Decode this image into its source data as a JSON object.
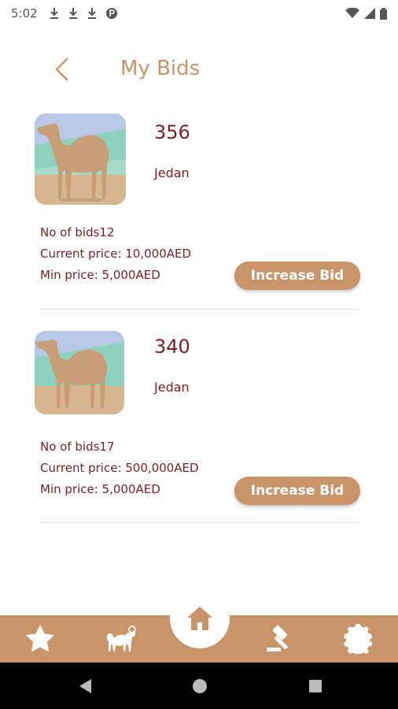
{
  "status_bar": {
    "time": "5:02",
    "left_icons": [
      "download-icon",
      "download-icon",
      "download-icon",
      "app-notification-icon"
    ],
    "right_icons": [
      "wifi-icon",
      "signal-icon",
      "battery-icon"
    ]
  },
  "header": {
    "title": "My Bids",
    "back_icon": "chevron-left-icon"
  },
  "bids": [
    {
      "id": "356",
      "name": "Jedan",
      "bids_line": "No of bids12",
      "current_price_line": "Current price: 10,000AED",
      "min_price_line": "Min price: 5,000AED",
      "button_label": "Increase Bid"
    },
    {
      "id": "340",
      "name": "Jedan",
      "bids_line": "No of bids17",
      "current_price_line": "Current price: 500,000AED",
      "min_price_line": "Min price: 5,000AED",
      "button_label": "Increase Bid"
    }
  ],
  "bottom_nav": {
    "items": [
      "star-icon",
      "camel-icon",
      "home-icon",
      "gavel-icon",
      "gear-icon"
    ],
    "active": "home-icon"
  },
  "colors": {
    "accent": "#c8956a",
    "text_dark_red": "#7a1f23"
  }
}
